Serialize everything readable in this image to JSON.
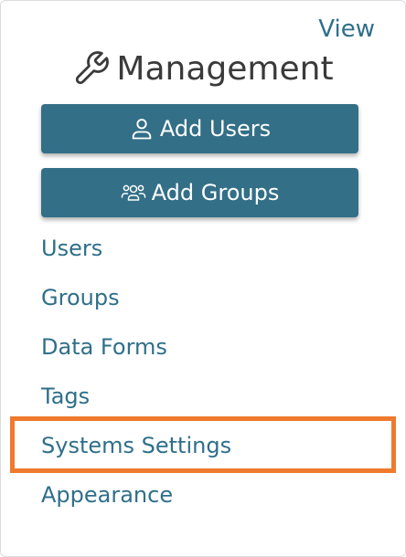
{
  "header": {
    "view_label": "View",
    "title": "Management",
    "title_icon": "wrench-icon"
  },
  "actions": {
    "add_users_label": "Add Users",
    "add_users_icon": "user-icon",
    "add_groups_label": "Add Groups",
    "add_groups_icon": "users-group-icon"
  },
  "nav": {
    "items": [
      {
        "label": "Users"
      },
      {
        "label": "Groups"
      },
      {
        "label": "Data Forms"
      },
      {
        "label": "Tags"
      },
      {
        "label": "Systems Settings",
        "highlighted": true
      },
      {
        "label": "Appearance"
      }
    ]
  },
  "colors": {
    "accent": "#336f87",
    "link": "#2f6f8a",
    "highlight": "#ef7a2e"
  }
}
